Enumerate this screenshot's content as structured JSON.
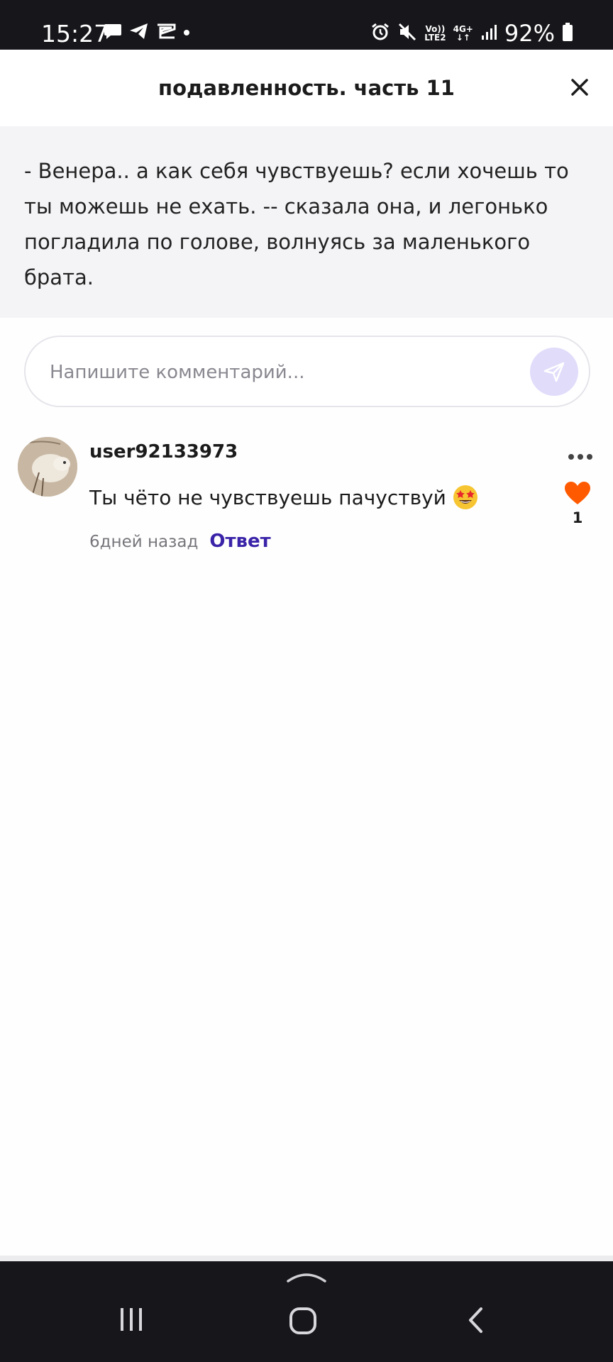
{
  "status_bar": {
    "time": "15:27",
    "network_top": "Vo))",
    "network_bottom": "LTE2",
    "signal_top": "4G+",
    "battery_percent": "92%",
    "left_icons": [
      "chat-bubble-icon",
      "telegram-icon",
      "capcut-icon",
      "dot-icon"
    ],
    "right_icons": [
      "alarm-icon",
      "mute-icon",
      "signal-bars-icon",
      "battery-icon"
    ]
  },
  "header": {
    "title": "подавленность. часть 11",
    "close_icon": "close-icon"
  },
  "excerpt": {
    "text": "- Венера.. а как себя чувствуешь? если хочешь то ты можешь не ехать. -- сказала она, и легонько погладила по голове, волнуясь за маленького брата."
  },
  "comment_input": {
    "placeholder": "Напишите комментарий...",
    "value": "",
    "send_icon": "send-icon"
  },
  "comments": [
    {
      "username": "user92133973",
      "text": "Ты чёто не чувствуешь пачуствуй",
      "emoji": "star-struck-emoji",
      "time": "6дней назад",
      "reply_label": "Ответ",
      "likes": "1"
    }
  ],
  "colors": {
    "accent": "#3a23a8",
    "send_button_bg": "#e2dcfb",
    "like_heart": "#ff5a00",
    "excerpt_bg": "#f4f3f6",
    "system_bar": "#17161b"
  }
}
